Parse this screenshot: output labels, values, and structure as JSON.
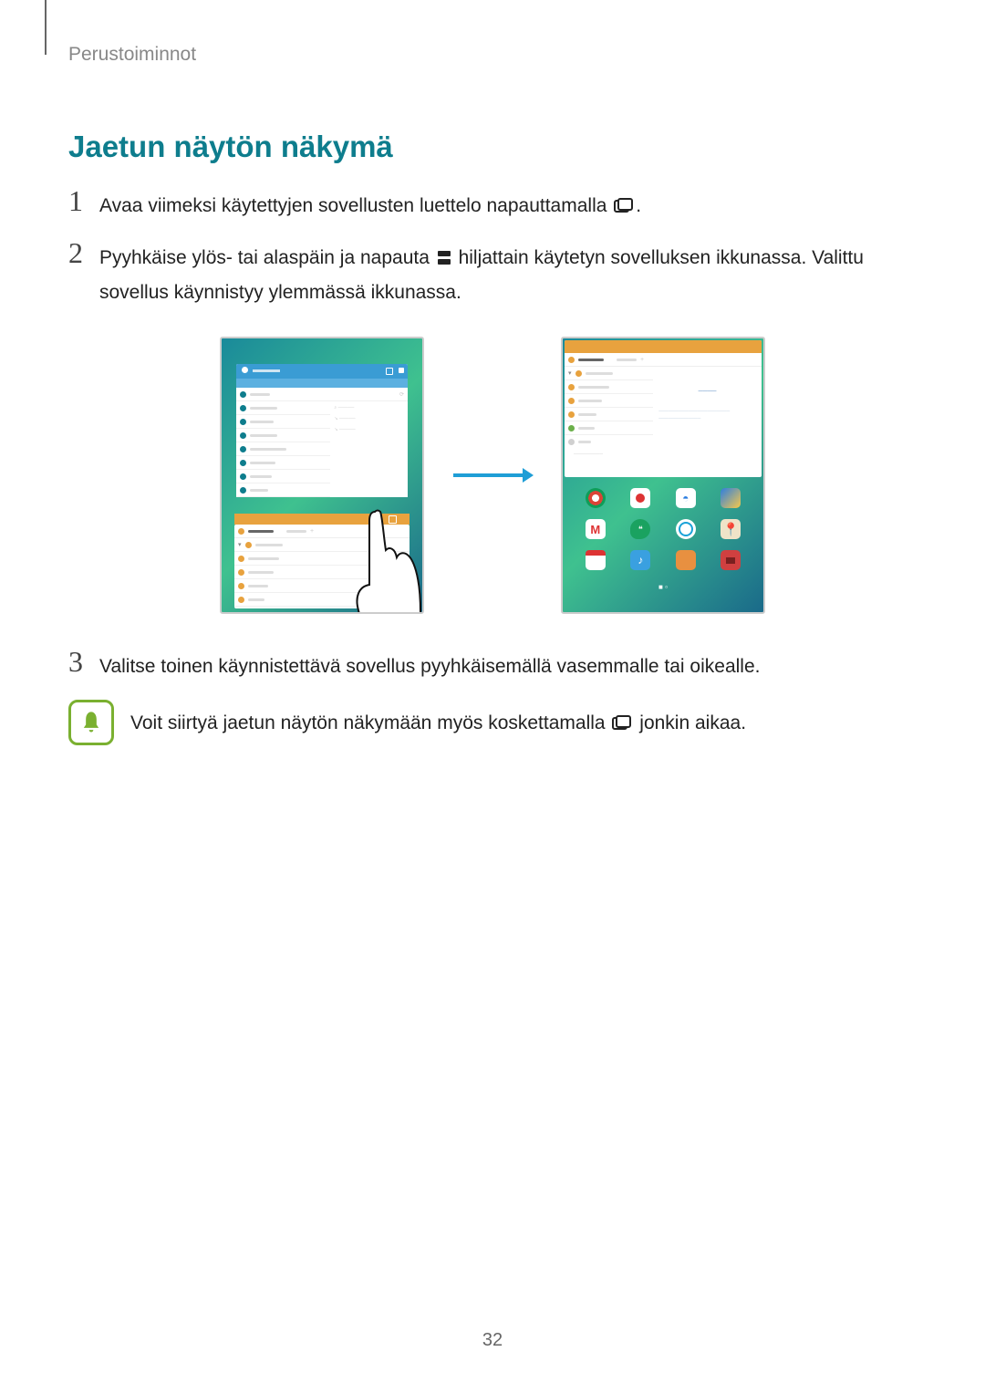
{
  "header": {
    "chapter": "Perustoiminnot"
  },
  "section": {
    "title": "Jaetun näytön näkymä"
  },
  "steps": {
    "s1": {
      "num": "1",
      "text": "Avaa viimeksi käytettyjen sovellusten luettelo napauttamalla"
    },
    "s2": {
      "num": "2",
      "text_a": "Pyyhkäise ylös- tai alaspäin ja napauta",
      "text_b": "hiljattain käytetyn sovelluksen ikkunassa. Valittu sovellus käynnistyy ylemmässä ikkunassa."
    },
    "s3": {
      "num": "3",
      "text": "Valitse toinen käynnistettävä sovellus pyyhkäisemällä vasemmalle tai oikealle."
    }
  },
  "note": {
    "text_a": "Voit siirtyä jaetun näytön näkymään myös koskettamalla",
    "text_b": "jonkin aikaa."
  },
  "page_number": "32"
}
